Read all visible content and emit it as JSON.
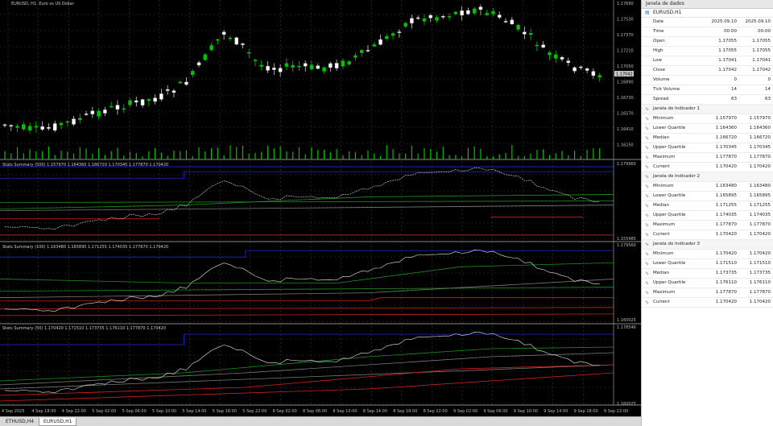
{
  "chart": {
    "title": "EURUSD, H1: Euro vs US Dollar",
    "main_prices": [
      "1.17690",
      "1.17530",
      "1.17370",
      "1.17210",
      "1.17050",
      "1.16890",
      "1.16730",
      "1.16570",
      "1.16410",
      "1.16250"
    ],
    "current_price": "1.17042",
    "ind1_label": "Stats Summary (500) 1.157970 1.164360 1.166720 1.170345 1.177870 1.170420",
    "ind1_scale": [
      "1.179960",
      "1.155485"
    ],
    "ind2_label": "Stats Summary (100) 1.163480 1.165895 1.171255 1.174035 1.177870 1.170420",
    "ind2_scale": [
      "1.179560",
      "1.160025"
    ],
    "ind3_label": "Stats Summary (50) 1.170420 1.171510 1.173735 1.176110 1.177870 1.170420",
    "ind3_scale": [
      "1.178546",
      "1.160025"
    ],
    "time_labels": [
      "4 Sep 2025",
      "4 Sep 18:00",
      "4 Sep 22:00",
      "5 Sep 02:00",
      "5 Sep 06:00",
      "5 Sep 10:00",
      "5 Sep 14:00",
      "5 Sep 18:00",
      "5 Sep 22:00",
      "8 Sep 02:00",
      "8 Sep 06:00",
      "8 Sep 10:00",
      "8 Sep 14:00",
      "8 Sep 18:00",
      "8 Sep 22:00",
      "9 Sep 02:00",
      "9 Sep 06:00",
      "9 Sep 10:00",
      "9 Sep 14:00",
      "9 Sep 18:00",
      "9 Sep 22:00"
    ]
  },
  "tabs": [
    "ETHUSD,H4",
    "EURUSD,H1"
  ],
  "data_window": {
    "title": "Janela de dados",
    "symbol": "EURUSD,H1",
    "rows": [
      {
        "label": "Date",
        "v1": "2025.09.10",
        "v2": "2025.09.10"
      },
      {
        "label": "Time",
        "v1": "00:00",
        "v2": "00:00"
      },
      {
        "label": "Open",
        "v1": "1.17055",
        "v2": "1.17055"
      },
      {
        "label": "High",
        "v1": "1.17055",
        "v2": "1.17055"
      },
      {
        "label": "Low",
        "v1": "1.17041",
        "v2": "1.17041"
      },
      {
        "label": "Close",
        "v1": "1.17042",
        "v2": "1.17042"
      },
      {
        "label": "Volume",
        "v1": "0",
        "v2": "0"
      },
      {
        "label": "Tick Volume",
        "v1": "14",
        "v2": "14"
      },
      {
        "label": "Spread",
        "v1": "63",
        "v2": "63"
      }
    ],
    "sections": [
      {
        "title": "Janela do Indicador 1",
        "rows": [
          {
            "label": "Minimum",
            "v1": "1.157970",
            "v2": "1.157970"
          },
          {
            "label": "Lower Quartile",
            "v1": "1.164360",
            "v2": "1.164360"
          },
          {
            "label": "Median",
            "v1": "1.166720",
            "v2": "1.166720"
          },
          {
            "label": "Upper Quartile",
            "v1": "1.170345",
            "v2": "1.170345"
          },
          {
            "label": "Maximum",
            "v1": "1.177870",
            "v2": "1.177870"
          },
          {
            "label": "Current",
            "v1": "1.170420",
            "v2": "1.170420"
          }
        ]
      },
      {
        "title": "Janela do Indicador 2",
        "rows": [
          {
            "label": "Minimum",
            "v1": "1.163480",
            "v2": "1.163480"
          },
          {
            "label": "Lower Quartile",
            "v1": "1.165895",
            "v2": "1.165895"
          },
          {
            "label": "Median",
            "v1": "1.171255",
            "v2": "1.171255"
          },
          {
            "label": "Upper Quartile",
            "v1": "1.174035",
            "v2": "1.174035"
          },
          {
            "label": "Maximum",
            "v1": "1.177870",
            "v2": "1.177870"
          },
          {
            "label": "Current",
            "v1": "1.170420",
            "v2": "1.170420"
          }
        ]
      },
      {
        "title": "Janela do Indicador 3",
        "rows": [
          {
            "label": "Minimum",
            "v1": "1.170420",
            "v2": "1.170420"
          },
          {
            "label": "Lower Quartile",
            "v1": "1.171510",
            "v2": "1.171510"
          },
          {
            "label": "Median",
            "v1": "1.173735",
            "v2": "1.173735"
          },
          {
            "label": "Upper Quartile",
            "v1": "1.176110",
            "v2": "1.176110"
          },
          {
            "label": "Maximum",
            "v1": "1.177870",
            "v2": "1.177870"
          },
          {
            "label": "Current",
            "v1": "1.170420",
            "v2": "1.170420"
          }
        ]
      }
    ]
  },
  "colors": {
    "bull": "#00c000",
    "bear": "#ffffff",
    "grid": "#3a3a3a",
    "blue": "#1f2bd6",
    "green": "#1f8f1f",
    "red": "#d62020",
    "dim": "#7a7a7a"
  }
}
